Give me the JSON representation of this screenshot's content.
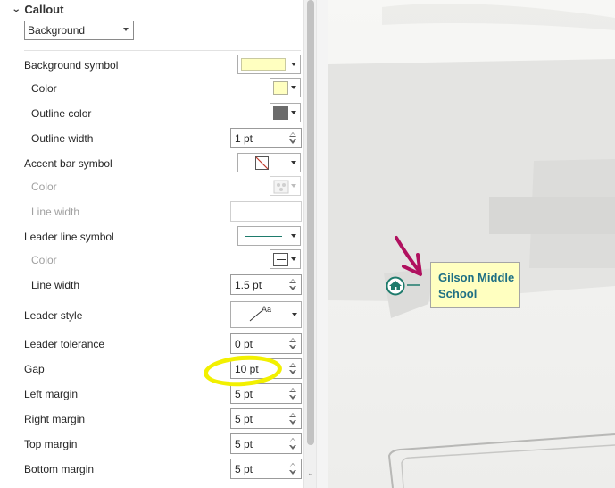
{
  "section": {
    "title": "Callout"
  },
  "type_select": {
    "value": "Background"
  },
  "rows": {
    "background_symbol": "Background symbol",
    "color": "Color",
    "outline_color": "Outline color",
    "outline_width": "Outline width",
    "accent_bar_symbol": "Accent bar symbol",
    "accent_color": "Color",
    "accent_line_width": "Line width",
    "leader_line_symbol": "Leader line symbol",
    "leader_color": "Color",
    "leader_line_width": "Line width",
    "leader_style": "Leader style",
    "leader_tolerance": "Leader tolerance",
    "gap": "Gap",
    "left_margin": "Left margin",
    "right_margin": "Right margin",
    "top_margin": "Top margin",
    "bottom_margin": "Bottom margin"
  },
  "values": {
    "outline_width": "1 pt",
    "leader_line_width": "1.5 pt",
    "leader_tolerance": "0 pt",
    "gap": "10 pt",
    "left_margin": "5 pt",
    "right_margin": "5 pt",
    "top_margin": "5 pt",
    "bottom_margin": "5 pt"
  },
  "leader_style_sample": "Aa",
  "map_label": {
    "line1": "Gilson Middle",
    "line2": "School"
  },
  "colors": {
    "background_fill": "#ffffc0",
    "outline": "#6b6b6b",
    "leader_line": "#1e7b6c",
    "label_text": "#1e6f84",
    "arrow": "#b0115f",
    "highlight": "#f2f000"
  },
  "icons": {
    "section_toggle": "chevron-down-icon",
    "school_marker": "school-icon"
  }
}
